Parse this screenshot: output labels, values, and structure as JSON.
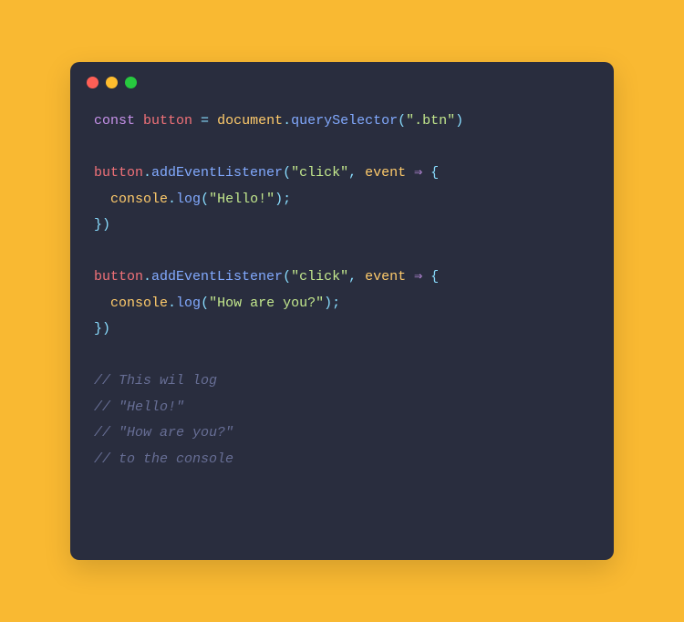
{
  "window": {
    "dots": [
      "red",
      "yellow",
      "green"
    ]
  },
  "code": {
    "line1": {
      "kw": "const",
      "var": "button",
      "eq": " = ",
      "obj": "document",
      "dot": ".",
      "fn": "querySelector",
      "open": "(",
      "str": "\".btn\"",
      "close": ")"
    },
    "listener1": {
      "var": "button",
      "dot": ".",
      "fn": "addEventListener",
      "open": "(",
      "argStr": "\"click\"",
      "comma": ", ",
      "argObj": "event",
      "arrow": " ⇒ ",
      "obrace": "{",
      "indent": "  ",
      "consoleObj": "console",
      "consoleDot": ".",
      "consoleFn": "log",
      "consoleOpen": "(",
      "consoleStr": "\"Hello!\"",
      "consoleClose": ");",
      "cbrace": "})"
    },
    "listener2": {
      "var": "button",
      "dot": ".",
      "fn": "addEventListener",
      "open": "(",
      "argStr": "\"click\"",
      "comma": ", ",
      "argObj": "event",
      "arrow": " ⇒ ",
      "obrace": "{",
      "indent": "  ",
      "consoleObj": "console",
      "consoleDot": ".",
      "consoleFn": "log",
      "consoleOpen": "(",
      "consoleStr": "\"How are you?\"",
      "consoleClose": ");",
      "cbrace": "})"
    },
    "comments": {
      "c1": "// This wil log",
      "c2": "// \"Hello!\"",
      "c3": "// \"How are you?\"",
      "c4": "// to the console"
    }
  }
}
